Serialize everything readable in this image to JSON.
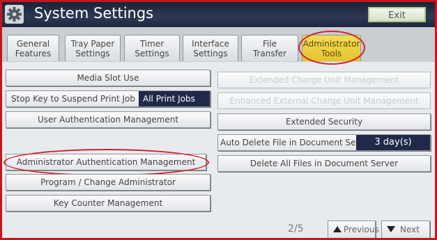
{
  "header": {
    "title": "System Settings",
    "exit_label": "Exit",
    "icon": "gear-icon"
  },
  "tabs": [
    {
      "line1": "General",
      "line2": "Features"
    },
    {
      "line1": "Tray Paper",
      "line2": "Settings"
    },
    {
      "line1": "Timer",
      "line2": "Settings"
    },
    {
      "line1": "Interface",
      "line2": "Settings"
    },
    {
      "line1": "File",
      "line2": "Transfer"
    },
    {
      "line1": "Administrator",
      "line2": "Tools",
      "active": true
    }
  ],
  "buttons": {
    "media_slot_use": "Media Slot Use",
    "stop_key_label": "Stop Key to Suspend Print Job",
    "stop_key_value": "All Print Jobs",
    "user_auth": "User Authentication Management",
    "admin_auth": "Administrator Authentication Management",
    "program_admin": "Program / Change Administrator",
    "key_counter": "Key Counter Management",
    "extended_charge": "Extended Charge Unit Management",
    "enhanced_charge": "Enhanced External Charge Unit Management",
    "extended_security": "Extended Security",
    "auto_delete_label": "Auto Delete File in Document Server",
    "auto_delete_value": "3 day(s)",
    "delete_all": "Delete All Files in Document Server"
  },
  "pagination": {
    "page": "2/5",
    "previous": "Previous",
    "next": "Next"
  },
  "colors": {
    "annotation": "#d21f2b",
    "active_tab": "#f0d34a",
    "title_bar": "#26314c"
  }
}
